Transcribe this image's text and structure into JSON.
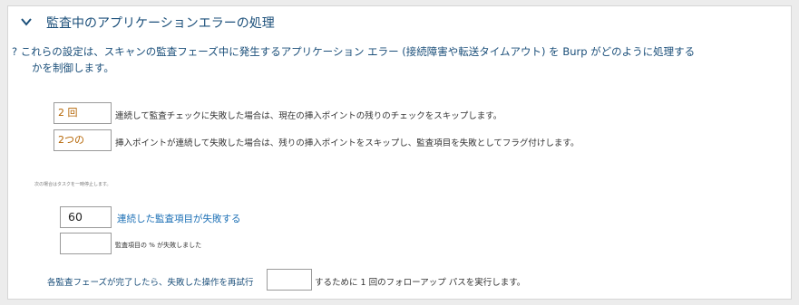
{
  "section": {
    "title": "監査中のアプリケーションエラーの処理",
    "help_mark": "?",
    "description_line1": "これらの設定は、スキャンの監査フェーズ中に発生するアプリケーション エラー (接続障害や転送タイムアウト) を Burp がどのように処理する",
    "description_line2": "かを制御します。"
  },
  "rules": {
    "consecutive_checks": {
      "value": "2 回",
      "label": "連続して監査チェックに失敗した場合は、現在の挿入ポイントの残りのチェックをスキップします。"
    },
    "consecutive_points": {
      "value": "2つの",
      "label": "挿入ポイントが連続して失敗した場合は、残りの挿入ポイントをスキップし、監査項目を失敗としてフラグ付けします。"
    }
  },
  "pause": {
    "note": "次の場合はタスクを一時停止します。",
    "consecutive_items": {
      "value": "60",
      "label": "連続した監査項目が失敗する"
    },
    "percent_items": {
      "value": "",
      "label": "監査項目の % が失敗しました"
    }
  },
  "retry": {
    "label_before": "各監査フェーズが完了したら、失敗した操作を再試行",
    "value": "",
    "label_after": "するために 1 回のフォローアップ パスを実行します。"
  }
}
